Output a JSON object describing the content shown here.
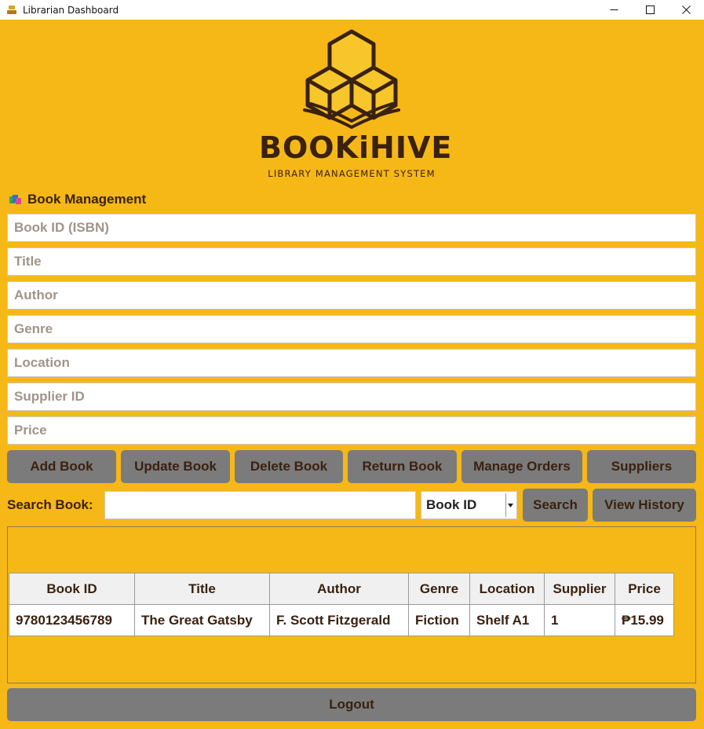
{
  "window": {
    "title": "Librarian Dashboard"
  },
  "brand": {
    "name": "BOOKiHIVE",
    "tagline": "LIBRARY MANAGEMENT SYSTEM"
  },
  "section": {
    "title": "Book Management",
    "icon": "books-icon"
  },
  "form": {
    "fields": [
      {
        "placeholder": "Book ID (ISBN)",
        "value": ""
      },
      {
        "placeholder": "Title",
        "value": ""
      },
      {
        "placeholder": "Author",
        "value": ""
      },
      {
        "placeholder": "Genre",
        "value": ""
      },
      {
        "placeholder": "Location",
        "value": ""
      },
      {
        "placeholder": "Supplier ID",
        "value": ""
      },
      {
        "placeholder": "Price",
        "value": ""
      }
    ]
  },
  "actions": {
    "add": "Add Book",
    "update": "Update Book",
    "delete": "Delete Book",
    "return": "Return Book",
    "orders": "Manage Orders",
    "suppliers": "Suppliers"
  },
  "search": {
    "label": "Search Book:",
    "value": "",
    "filter_selected": "Book ID",
    "search_button": "Search",
    "history_button": "View History"
  },
  "table": {
    "columns": [
      "Book ID",
      "Title",
      "Author",
      "Genre",
      "Location",
      "Supplier",
      "Price"
    ],
    "rows": [
      [
        "9780123456789",
        "The Great Gatsby",
        "F. Scott Fitzgerald",
        "Fiction",
        "Shelf A1",
        "1",
        "₱15.99"
      ]
    ]
  },
  "footer": {
    "logout": "Logout"
  },
  "colors": {
    "background": "#f6b817",
    "button": "#7b7b7b",
    "text_dark": "#3a2110"
  }
}
